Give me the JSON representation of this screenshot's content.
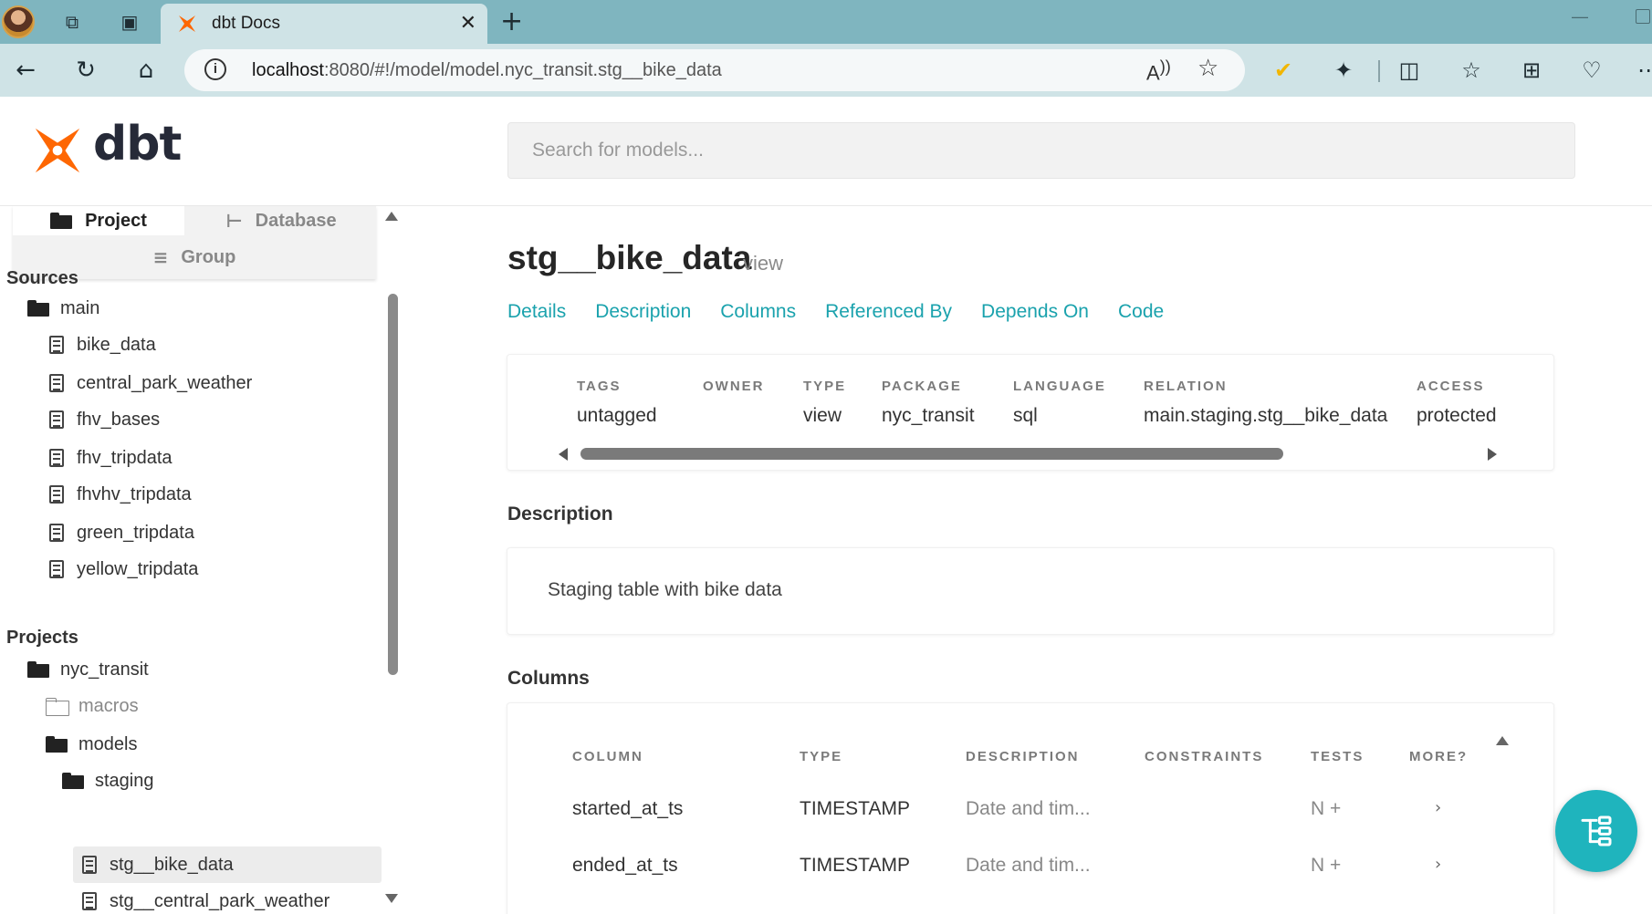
{
  "browser": {
    "tab_title": "dbt Docs",
    "url_host": "localhost",
    "url_rest": ":8080/#!/model/model.nyc_transit.stg__bike_data"
  },
  "app": {
    "logo_text": "dbt",
    "search_placeholder": "Search for models...",
    "brand_color": "#fe6703",
    "accent_color": "#1aa2ad"
  },
  "sidebar": {
    "tabs": {
      "project": "Project",
      "database": "Database",
      "group": "Group"
    },
    "sources_title": "Sources",
    "sources_folder": "main",
    "sources": [
      "bike_data",
      "central_park_weather",
      "fhv_bases",
      "fhv_tripdata",
      "fhvhv_tripdata",
      "green_tripdata",
      "yellow_tripdata"
    ],
    "projects_title": "Projects",
    "project_name": "nyc_transit",
    "folders": {
      "macros": "macros",
      "models": "models",
      "staging": "staging"
    },
    "staging_models": [
      "stg__bike_data",
      "stg__central_park_weather"
    ]
  },
  "model": {
    "name": "stg__bike_data",
    "materialization": "view",
    "nav": [
      "Details",
      "Description",
      "Columns",
      "Referenced By",
      "Depends On",
      "Code"
    ],
    "details": {
      "tags_label": "TAGS",
      "tags": "untagged",
      "owner_label": "OWNER",
      "owner": "",
      "type_label": "TYPE",
      "type": "view",
      "package_label": "PACKAGE",
      "package": "nyc_transit",
      "language_label": "LANGUAGE",
      "language": "sql",
      "relation_label": "RELATION",
      "relation": "main.staging.stg__bike_data",
      "access_label": "ACCESS",
      "access": "protected"
    },
    "description_heading": "Description",
    "description": "Staging table with bike data",
    "columns_heading": "Columns",
    "columns_headers": [
      "COLUMN",
      "TYPE",
      "DESCRIPTION",
      "CONSTRAINTS",
      "TESTS",
      "MORE?"
    ],
    "columns": [
      {
        "name": "started_at_ts",
        "type": "TIMESTAMP",
        "description": "Date and tim...",
        "constraints": "",
        "tests": "N +",
        "more": "›"
      },
      {
        "name": "ended_at_ts",
        "type": "TIMESTAMP",
        "description": "Date and tim...",
        "constraints": "",
        "tests": "N +",
        "more": "›"
      }
    ]
  }
}
